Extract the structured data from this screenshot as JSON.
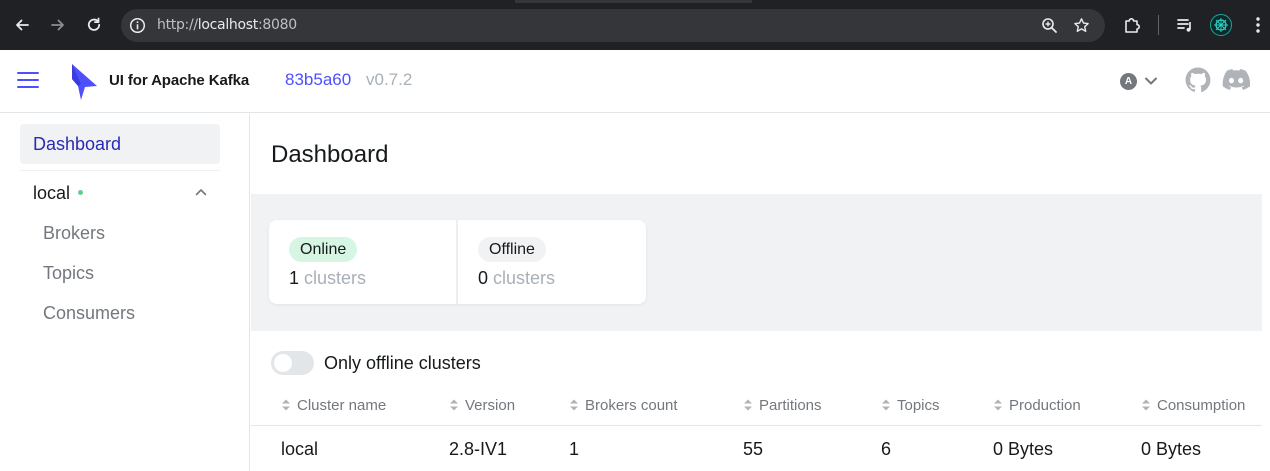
{
  "browser": {
    "url_scheme": "http://",
    "url_host": "localhost",
    "url_port": ":8080"
  },
  "header": {
    "app_title": "UI for Apache Kafka",
    "commit": "83b5a60",
    "version": "v0.7.2",
    "user_initial": "A"
  },
  "sidebar": {
    "dashboard_label": "Dashboard",
    "cluster_name": "local",
    "items": [
      {
        "label": "Brokers"
      },
      {
        "label": "Topics"
      },
      {
        "label": "Consumers"
      }
    ]
  },
  "main": {
    "title": "Dashboard",
    "metrics": {
      "online_label": "Online",
      "online_count": "1",
      "offline_label": "Offline",
      "offline_count": "0",
      "unit": "clusters"
    },
    "toggle_label": "Only offline clusters",
    "table": {
      "columns": [
        "Cluster name",
        "Version",
        "Brokers count",
        "Partitions",
        "Topics",
        "Production",
        "Consumption"
      ],
      "rows": [
        {
          "cluster": "local",
          "version": "2.8-IV1",
          "brokers": "1",
          "partitions": "55",
          "topics": "6",
          "production": "0 Bytes",
          "consumption": "0 Bytes"
        }
      ]
    }
  },
  "colors": {
    "accent": "#4f4fff",
    "online_badge": "#d6f5e3",
    "status_dot": "#5ecf8f"
  }
}
